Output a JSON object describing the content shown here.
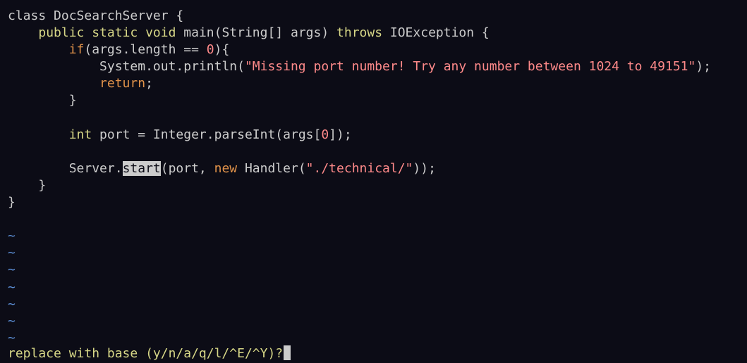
{
  "code": {
    "l1": {
      "a": "class DocSearchServer {"
    },
    "l2": {
      "indent": "    ",
      "kw": "public static void",
      "mid": " main(String[] args) ",
      "throws": "throws",
      "end": " IOException {"
    },
    "l3": {
      "indent": "        ",
      "kw": "if",
      "mid": "(args.length == ",
      "num": "0",
      "end": "){"
    },
    "l4": {
      "indent": "            ",
      "pre": "System.out.println(",
      "str": "\"Missing port number! Try any number between 1024 to 49151\"",
      "end": ");"
    },
    "l5": {
      "indent": "            ",
      "kw": "return",
      "end": ";"
    },
    "l6": {
      "indent": "        ",
      "end": "}"
    },
    "l8": {
      "indent": "        ",
      "kw": "int",
      "mid": " port = Integer.parseInt(args[",
      "num": "0",
      "end": "]);"
    },
    "l10": {
      "indent": "        ",
      "pre": "Server.",
      "hl": "start",
      "mid": "(port, ",
      "kw": "new",
      "mid2": " Handler(",
      "str": "\"./technical/\"",
      "end": "));"
    },
    "l11": {
      "indent": "    ",
      "end": "}"
    },
    "l12": {
      "end": "}"
    }
  },
  "tilde": "~",
  "status": {
    "text": "replace with base (y/n/a/q/l/^E/^Y)?"
  },
  "colors": {
    "background": "#0c0c16",
    "text": "#cccccc",
    "keyword": "#d7d787",
    "control": "#e2934a",
    "string": "#ff8a8a",
    "tilde": "#5c8fd6"
  }
}
